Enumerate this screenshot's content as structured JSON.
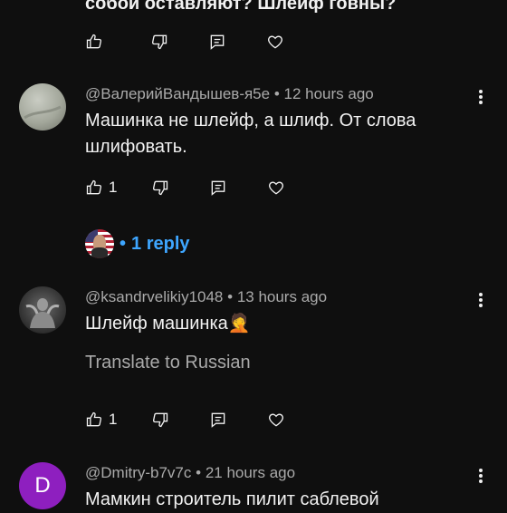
{
  "comments": [
    {
      "text": "собой оставляют? Шлейф говны?",
      "likes": ""
    },
    {
      "author": "@ВалерийВандышев-я5е",
      "time": "12 hours ago",
      "text_lines": [
        "Машинка не шлейф, а шлиф. От слова",
        "шлифовать."
      ],
      "likes": "1",
      "replies_label": "1 reply"
    },
    {
      "author": "@ksandrvelikiy1048",
      "time": "13 hours ago",
      "text": "Шлейф машинка",
      "emoji": "🤦",
      "translate_label": "Translate to Russian",
      "likes": "1"
    },
    {
      "author": "@Dmitry-b7v7c",
      "time": "21 hours ago",
      "avatar_letter": "D",
      "text": "Мамкин строитель пилит саблевой"
    }
  ],
  "separator": "•",
  "colors": {
    "background": "#0f0f0f",
    "link": "#3ea6ff",
    "avatar_purple": "#8e1fbf",
    "meta": "#aaaaaa"
  }
}
